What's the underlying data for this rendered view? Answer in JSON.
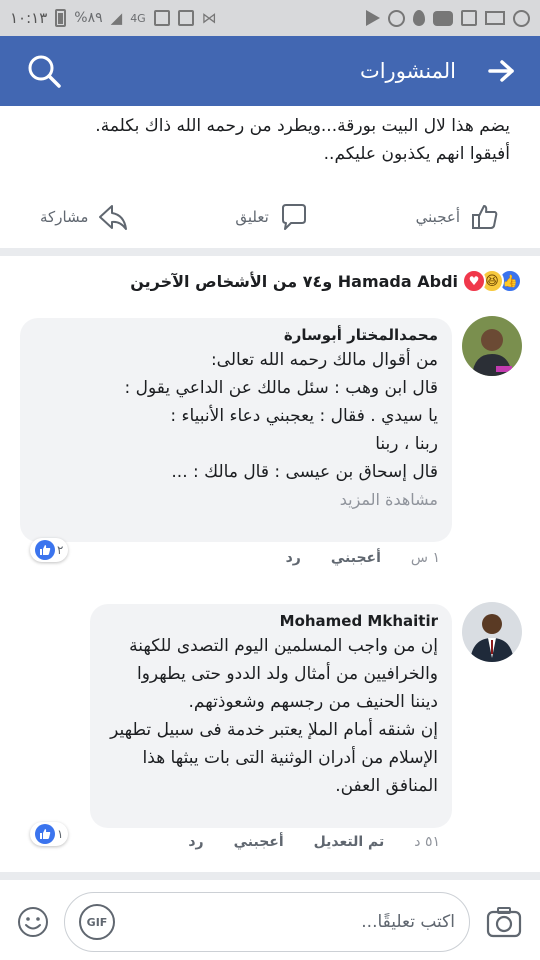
{
  "status_bar": {
    "time": "١٠:١٣",
    "battery": "%٨٩",
    "network": "4G"
  },
  "header": {
    "title": "المنشورات"
  },
  "post": {
    "text_line1": "يضم هذا لال البيت بورقة...ويطرد من رحمه الله ذاك بكلمة.",
    "text_line2": "أفيقوا انهم يكذبون عليكم.."
  },
  "actions": {
    "like": "أعجبني",
    "comment": "تعليق",
    "share": "مشاركة"
  },
  "reactions": {
    "summary": "Hamada Abdi و٧٤ من الأشخاص الآخرين"
  },
  "comments": [
    {
      "author": "محمدالمختار أبوسارة",
      "text": "من أقوال مالك رحمه الله تعالى:\n قال ابن وهب : سئل مالك عن الداعي يقول :\nيا سيدي . فقال : يعجبني دعاء الأنبياء :\nربنا ، ربنا\n قال إسحاق بن عيسى  : قال مالك  : ...",
      "see_more": "مشاهدة المزيد",
      "time": "١ س",
      "like": "أعجبني",
      "reply": "رد",
      "likes_count": "٢"
    },
    {
      "author": "Mohamed Mkhaitir",
      "text": "إن من واجب المسلمين اليوم التصدى للكهنة\nوالخرافيين من أمثال ولد الددو حتى يطهروا\nديننا الحنيف من رجسهم وشعوذتهم.\nإن شنقه أمام الملإ يعتبر خدمة فى سبيل تطهير\nالإسلام من أدران الوثنية التى بات يبثها هذا\nالمنافق العفن.",
      "time": "٥١ د",
      "edited": "تم التعديل",
      "like": "أعجبني",
      "reply": "رد",
      "likes_count": "١"
    }
  ],
  "composer": {
    "placeholder": "اكتب تعليقًا...",
    "gif_label": "GIF"
  },
  "colors": {
    "brand": "#4267b2",
    "like_blue": "#3b74ee",
    "love_red": "#f0384b"
  }
}
